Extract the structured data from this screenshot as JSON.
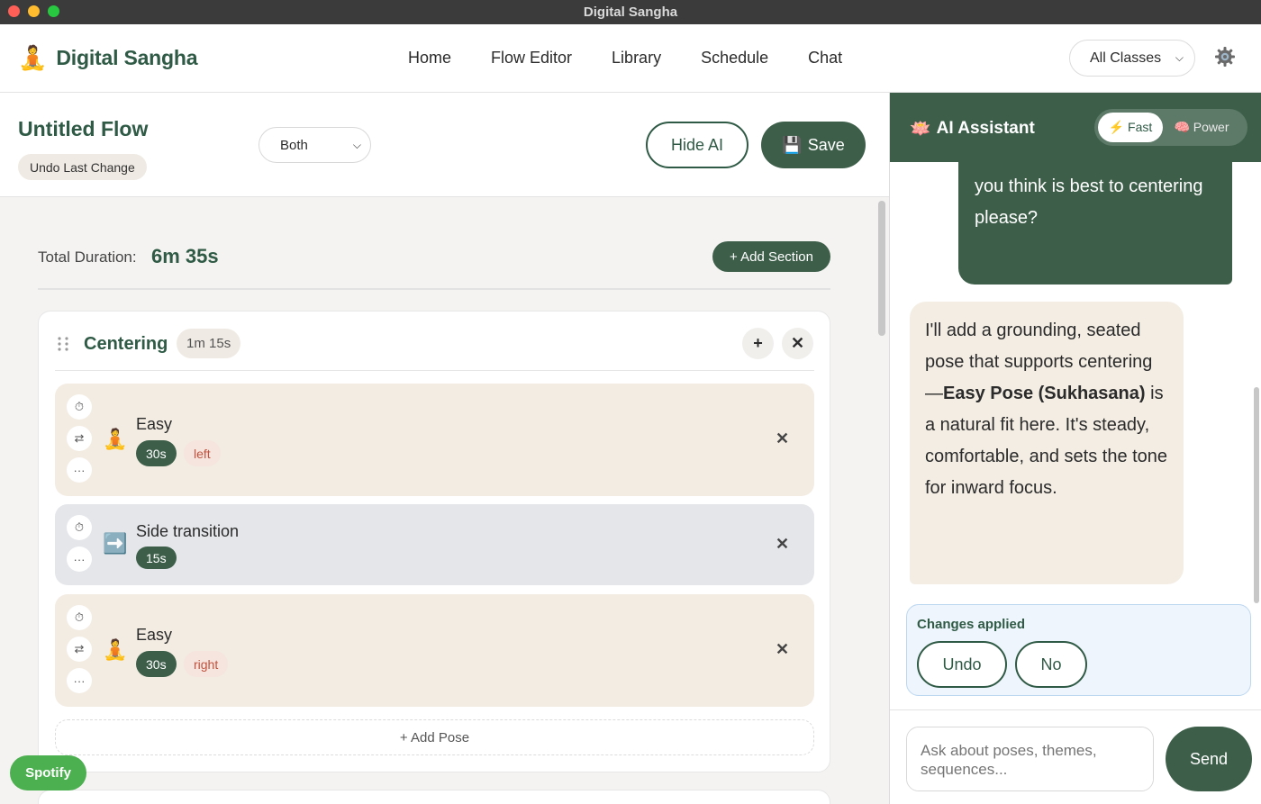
{
  "window": {
    "title": "Digital Sangha"
  },
  "nav": {
    "brand": "Digital Sangha",
    "brand_icon": "🧘",
    "links": [
      "Home",
      "Flow Editor",
      "Library",
      "Schedule",
      "Chat"
    ],
    "class_filter": "All Classes"
  },
  "flow": {
    "title": "Untitled Flow",
    "undo_label": "Undo Last Change",
    "side_select": "Both",
    "hide_ai_label": "Hide AI",
    "save_label": "Save",
    "save_icon": "💾",
    "total_label": "Total Duration:",
    "total_value": "6m 35s",
    "add_section_label": "+ Add Section",
    "add_pose_label": "+ Add Pose",
    "sections": [
      {
        "title": "Centering",
        "duration": "1m 15s",
        "poses": [
          {
            "name": "Easy",
            "duration": "30s",
            "side": "left",
            "emoji": "🧘"
          },
          {
            "name": "Side transition",
            "duration": "15s",
            "emoji": "➡️"
          },
          {
            "name": "Easy",
            "duration": "30s",
            "side": "right",
            "emoji": "🧘"
          }
        ]
      }
    ]
  },
  "spotify": {
    "label": "Spotify"
  },
  "ai": {
    "title": "AI Assistant",
    "title_icon": "🪷",
    "modes": {
      "fast": "⚡ Fast",
      "power": "🧠 Power"
    },
    "user_message": "you think is best to centering please?",
    "assistant": {
      "pre": "I'll add a grounding, seated pose that supports centering—",
      "bold": "Easy Pose (Sukhasana)",
      "post": " is a natural fit here. It's steady, comfortable, and sets the tone for inward focus."
    },
    "changes_title": "Changes applied",
    "undo_label": "Undo",
    "no_label": "No",
    "input_placeholder": "Ask about poses, themes, sequences...",
    "send_label": "Send"
  },
  "colors": {
    "brand": "#3d5f4a",
    "side_text": "#c0533d",
    "changes_border": "#bcd7f0"
  }
}
